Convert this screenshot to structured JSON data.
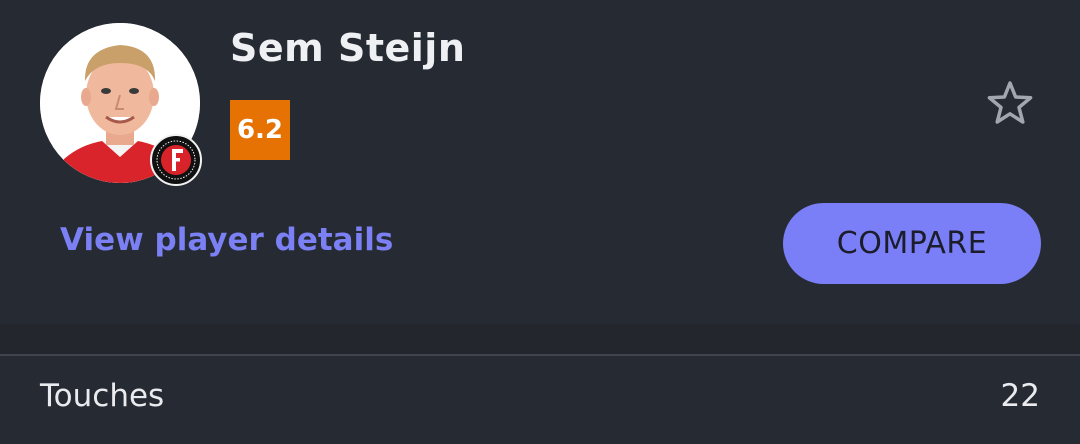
{
  "player": {
    "name": "Sem Steijn",
    "rating": "6.2",
    "rating_color": "#e57203",
    "club_badge_icon": "feyenoord-crest-icon",
    "favorite_icon": "star-outline-icon"
  },
  "actions": {
    "view_details_label": "View player details",
    "compare_label": "COMPARE",
    "accent_color": "#7a7ff7"
  },
  "stats": [
    {
      "label": "Touches",
      "value": "22"
    }
  ]
}
